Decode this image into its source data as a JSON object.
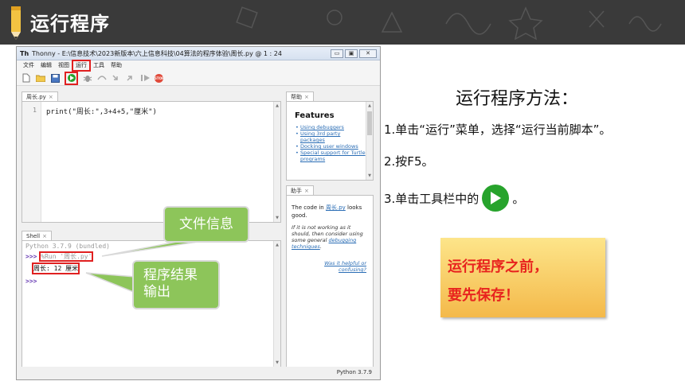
{
  "slide": {
    "title": "运行程序"
  },
  "window": {
    "title": "Thonny  -  E:\\信息技术\\2023新版本\\六上信息科技\\04算法的程序体验\\周长.py  @  1 : 24",
    "app_icon": "Th",
    "buttons": {
      "minimize": "▭",
      "maximize": "▣",
      "close": "✕"
    }
  },
  "menu": {
    "items": [
      "文件",
      "编辑",
      "视图",
      "运行",
      "工具",
      "帮助"
    ],
    "highlighted": "运行"
  },
  "toolbar": {
    "icons": [
      "new-file-icon",
      "open-folder-icon",
      "save-icon",
      "run-icon",
      "debug-icon",
      "step-over-icon",
      "step-into-icon",
      "step-out-icon",
      "resume-icon",
      "stop-icon"
    ],
    "stop_label": "STOP",
    "run_color": "#27a32c"
  },
  "editor": {
    "tab_label": "周长.py",
    "tab_close": "×",
    "line_number": "1",
    "code": "print(\"周长:\",3+4+5,\"厘米\")"
  },
  "shell": {
    "tab_label": "Shell",
    "tab_close": "×",
    "version_line": "Python 3.7.9 (bundled)",
    "prompt": ">>>",
    "run_command": "%Run '周长.py'",
    "output": "周长: 12 厘米"
  },
  "help": {
    "tab_label": "帮助",
    "tab_close": "×",
    "features_title": "Features",
    "items": [
      "Using debuggers",
      "Using 3rd party packages",
      "Docking user windows",
      "Special support for Turtle programs"
    ]
  },
  "assistant": {
    "tab_label": "助手",
    "tab_close": "×",
    "intro_before": "The code in ",
    "intro_link": "周长.py",
    "intro_after": " looks good.",
    "italic_before": "If it is not working as it should, then consider using some general ",
    "italic_link": "debugging techniques",
    "italic_after": ".",
    "helpful": "Was it helpful or confusing?"
  },
  "status": {
    "python_version": "Python 3.7.9"
  },
  "callouts": {
    "file_info": "文件信息",
    "result_line1": "程序结果",
    "result_line2": "输出",
    "color": "#8dc55a"
  },
  "instructions": {
    "title": "运行程序方法：",
    "step1": "1.单击“运行”菜单，选择“运行当前脚本”。",
    "step2": "2.按F5。",
    "step3_before": "3.单击工具栏中的",
    "step3_after": "。"
  },
  "warning": {
    "line1": "运行程序之前，",
    "line2": "要先保存！",
    "color": "#e8231e"
  }
}
